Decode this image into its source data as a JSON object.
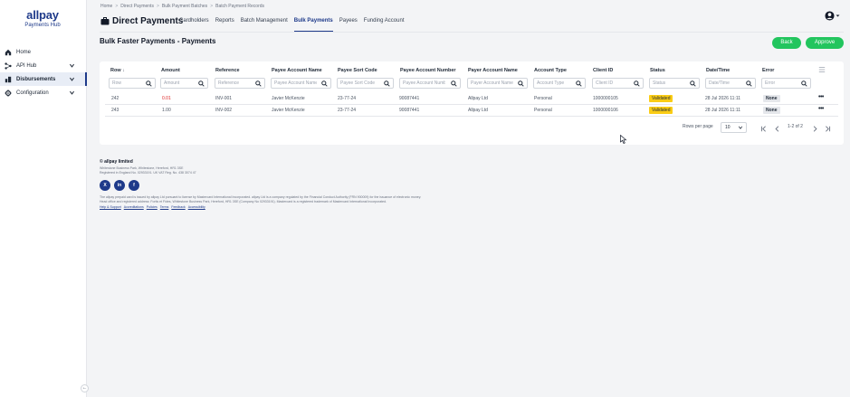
{
  "brand": {
    "name": "allpay",
    "subtitle": "Payments Hub",
    "color": "#1e3a8a"
  },
  "sidebar": {
    "items": [
      {
        "label": "Home",
        "icon": "home-icon"
      },
      {
        "label": "API Hub",
        "icon": "api-hub-icon"
      },
      {
        "label": "Disbursements",
        "icon": "disbursements-icon",
        "active": true
      },
      {
        "label": "Configuration",
        "icon": "gear-icon"
      }
    ],
    "collapse_glyph": "←"
  },
  "breadcrumb": [
    "Home",
    "Direct Payments",
    "Bulk Payment Batches",
    "Batch Payment Records"
  ],
  "breadcrumb_sep": ">",
  "header": {
    "app_title": "Direct Payments",
    "tabs": [
      "Cardholders",
      "Reports",
      "Batch Management",
      "Bulk Payments",
      "Payees",
      "Funding Account"
    ],
    "active_tab": "Bulk Payments"
  },
  "page": {
    "title": "Bulk Faster Payments - Payments",
    "back_label": "Back",
    "approve_label": "Approve",
    "accent": "#22c55e"
  },
  "table": {
    "columns": [
      "Row",
      "Amount",
      "Reference",
      "Payee Account Name",
      "Payee Sort Code",
      "Payee Account Number",
      "Payer Account Name",
      "Account Type",
      "Client ID",
      "Status",
      "Date/Time",
      "Error"
    ],
    "sort_glyph": "↓",
    "filters": [
      "Row",
      "Amount",
      "Reference",
      "Payee Account Name",
      "Payee Sort Code",
      "Payee Account Number",
      "Payer Account Name",
      "Account Type",
      "Client ID",
      "Status",
      "Date/Time",
      "Error"
    ],
    "rows": [
      {
        "row": "242",
        "amount": "0.01",
        "reference": "INV-001",
        "payee_name": "Javier McKenzie",
        "sort_code": "23-77-24",
        "account_number": "90087441",
        "payer_name": "Allpay Ltd",
        "account_type": "Personal",
        "client_id": "1000000105",
        "status": "Validated",
        "datetime": "28 Jul 2026 11:11",
        "error": "None"
      },
      {
        "row": "243",
        "amount": "1.00",
        "reference": "INV-002",
        "payee_name": "Javier McKenzie",
        "sort_code": "23-77-24",
        "account_number": "90087441",
        "payer_name": "Allpay Ltd",
        "account_type": "Personal",
        "client_id": "1000000106",
        "status": "Validated",
        "datetime": "28 Jul 2026 11:11",
        "error": "None"
      }
    ],
    "more_glyph": "•••",
    "status_color": "#facc15",
    "amount_negative_color": "#dc2626"
  },
  "pagination": {
    "rows_per_page_label": "Rows per page",
    "rows_per_page": "10",
    "page_info": "1-2 of 2"
  },
  "footer": {
    "company": "© allpay limited",
    "address_line1": "Whitestone Business Park, Whitestone, Hereford, HR1 3SE",
    "address_line2": "Registered in England No. 02933191. UK VAT Reg. No. 438 3074 47",
    "socials": [
      "X",
      "in",
      "f"
    ],
    "legal_line1": "The allpay prepaid card is issued by allpay Ltd pursuant to license by Mastercard International Incorporated. allpay Ltd is a company regulated by the Financial Conduct Authority (FRN 900009) for the issuance of electronic money.",
    "legal_line2": "Head office and registered address: Fortis et Fides, Whitestone Business Park, Hereford, HR1 3SE (Company No 02933191). Mastercard is a registered trademark of Mastercard International Incorporated.",
    "links": [
      "Help & Support",
      "Accreditations",
      "Policies",
      "Terms",
      "Feedback",
      "Accessibility"
    ]
  }
}
